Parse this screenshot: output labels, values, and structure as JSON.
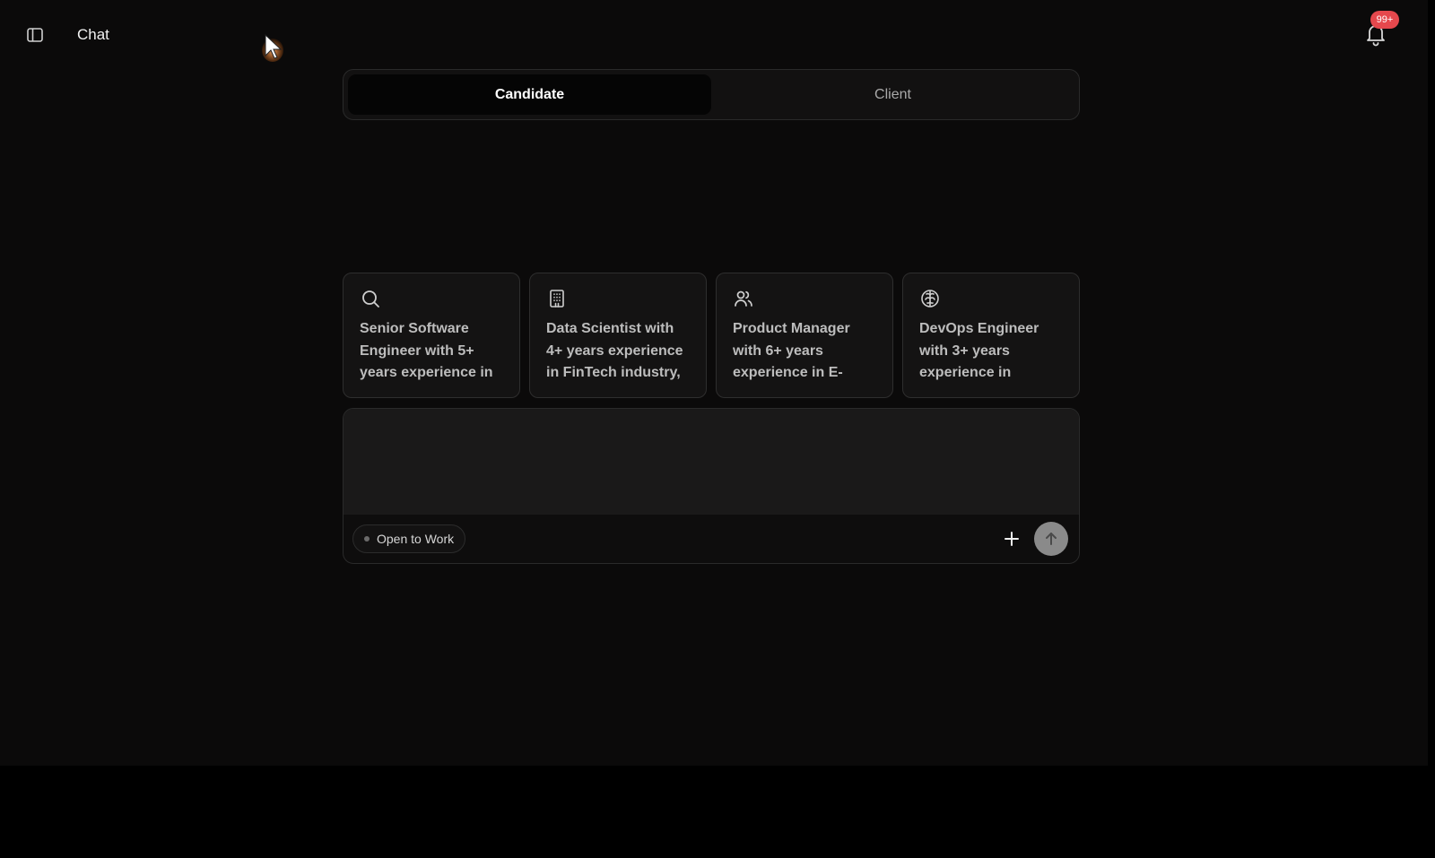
{
  "header": {
    "title": "Chat",
    "sidebar_toggle_icon": "sidebar-panel-icon",
    "notifications": {
      "icon": "bell-icon",
      "badge": "99+",
      "badge_color": "#e5484d"
    }
  },
  "mode_tabs": [
    {
      "label": "Candidate",
      "active": true
    },
    {
      "label": "Client",
      "active": false
    }
  ],
  "suggestions": [
    {
      "icon": "search-icon",
      "text": "Senior Software Engineer with 5+ years experience in"
    },
    {
      "icon": "building-icon",
      "text": "Data Scientist with 4+ years experience in FinTech industry,"
    },
    {
      "icon": "users-icon",
      "text": "Product Manager with 6+ years experience in E-"
    },
    {
      "icon": "brain-icon",
      "text": "DevOps Engineer with 3+ years experience in"
    }
  ],
  "composer": {
    "value": "",
    "status_chip": "Open to Work",
    "add_icon": "plus-icon",
    "send_icon": "arrow-up-icon"
  },
  "colors": {
    "background": "#0b0a0a",
    "card_background": "#141313",
    "send_button": "#8a8a8a"
  }
}
